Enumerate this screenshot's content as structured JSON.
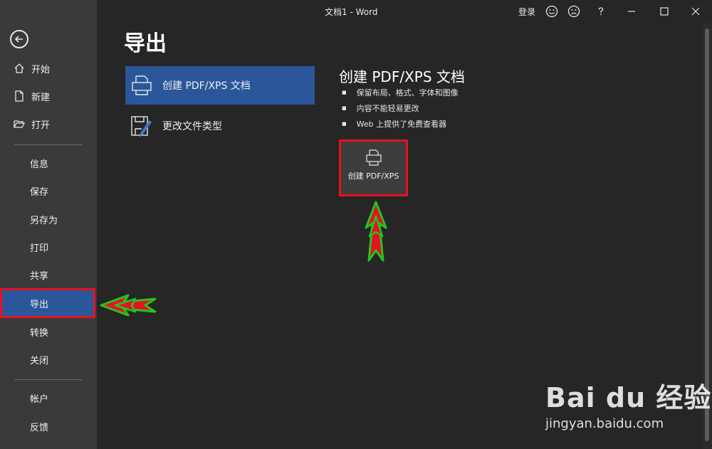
{
  "window": {
    "title": "文档1  -  Word",
    "login_label": "登录",
    "icons": [
      "smile-icon",
      "frown-icon",
      "help-icon",
      "minimize-icon",
      "restore-icon",
      "close-icon"
    ]
  },
  "sidebar": {
    "back_icon": "back-arrow-icon",
    "top_items": [
      {
        "label": "开始",
        "icon": "home-icon"
      },
      {
        "label": "新建",
        "icon": "new-document-icon"
      },
      {
        "label": "打开",
        "icon": "open-folder-icon"
      }
    ],
    "middle_items": [
      "信息",
      "保存",
      "另存为",
      "打印",
      "共享",
      "导出",
      "转换",
      "关闭"
    ],
    "active_item": "导出",
    "bottom_items": [
      "帐户",
      "反馈"
    ]
  },
  "main": {
    "title": "导出",
    "options": [
      {
        "label": "创建 PDF/XPS 文档",
        "icon": "pdf-document-icon",
        "selected": true
      },
      {
        "label": "更改文件类型",
        "icon": "change-file-type-icon",
        "selected": false
      }
    ],
    "detail": {
      "title": "创建 PDF/XPS 文档",
      "bullets": [
        "保留布局、格式、字体和图像",
        "内容不能轻易更改",
        "Web 上提供了免费查看器"
      ],
      "button_label": "创建 PDF/XPS",
      "button_icon": "printer-document-icon"
    }
  },
  "watermark": {
    "brand": "Bai du 经验",
    "url": "jingyan.baidu.com"
  },
  "colors": {
    "sidebar_bg": "#3a3a3a",
    "content_bg": "#262626",
    "accent_blue": "#2b579a",
    "highlight_red": "#e81123",
    "arrow_green": "#22c51f"
  }
}
